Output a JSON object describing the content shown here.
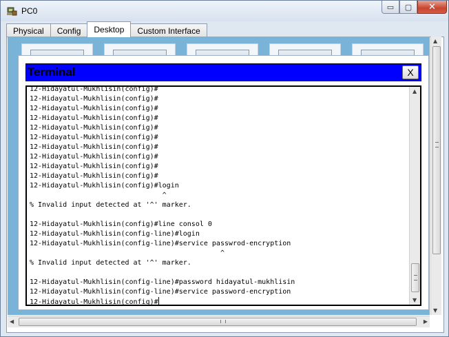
{
  "window": {
    "title": "PC0",
    "minimize_glyph": "▭",
    "maximize_glyph": "▢",
    "close_glyph": "✕"
  },
  "tabs": [
    {
      "label": "Physical",
      "active": false
    },
    {
      "label": "Config",
      "active": false
    },
    {
      "label": "Desktop",
      "active": true
    },
    {
      "label": "Custom Interface",
      "active": false
    }
  ],
  "terminal": {
    "title": "Terminal",
    "close_label": "X",
    "lines": [
      "12-Hidayatul-Mukhlisin(config)#",
      "12-Hidayatul-Mukhlisin(config)#",
      "12-Hidayatul-Mukhlisin(config)#",
      "12-Hidayatul-Mukhlisin(config)#",
      "12-Hidayatul-Mukhlisin(config)#",
      "12-Hidayatul-Mukhlisin(config)#",
      "12-Hidayatul-Mukhlisin(config)#",
      "12-Hidayatul-Mukhlisin(config)#",
      "12-Hidayatul-Mukhlisin(config)#",
      "12-Hidayatul-Mukhlisin(config)#",
      "12-Hidayatul-Mukhlisin(config)#login",
      "                                ^",
      "% Invalid input detected at '^' marker.",
      "",
      "12-Hidayatul-Mukhlisin(config)#line consol 0",
      "12-Hidayatul-Mukhlisin(config-line)#login",
      "12-Hidayatul-Mukhlisin(config-line)#service passwrod-encryption",
      "                                              ^",
      "% Invalid input detected at '^' marker.",
      "",
      "12-Hidayatul-Mukhlisin(config-line)#password hidayatul-mukhlisin",
      "12-Hidayatul-Mukhlisin(config-line)#service password-encryption",
      "12-Hidayatul-Mukhlisin(config)#"
    ]
  },
  "colors": {
    "terminal_header": "#0000ff",
    "desktop_background": "#7ab3d8"
  }
}
